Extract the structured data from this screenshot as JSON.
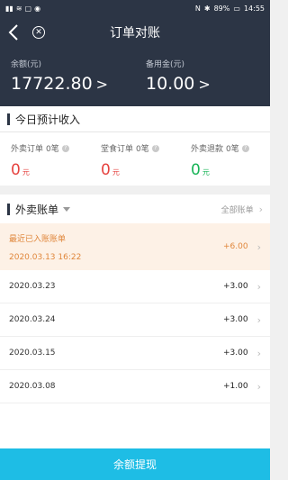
{
  "status": {
    "left_icons": [
      "signal-icon",
      "wifi-icon",
      "message-icon",
      "app-icon"
    ],
    "battery": "89%",
    "time": "14:55"
  },
  "nav": {
    "title": "订单对账",
    "back_icon": "back-icon",
    "close_icon": "close-icon"
  },
  "summary": {
    "balance_label": "余额(元)",
    "balance_value": "17722.80",
    "reserve_label": "备用金(元)",
    "reserve_value": "10.00",
    "chevron": ">"
  },
  "income": {
    "title": "今日预计收入",
    "items": [
      {
        "label": "外卖订单",
        "count": "0笔",
        "value": "0",
        "unit": "元"
      },
      {
        "label": "堂食订单",
        "count": "0笔",
        "value": "0",
        "unit": "元"
      },
      {
        "label": "外卖退款",
        "count": "0笔",
        "value": "0",
        "unit": "元"
      }
    ]
  },
  "bill": {
    "title": "外卖账单",
    "all_label": "全部账单",
    "recent": {
      "label": "最近已入账账单",
      "date": "2020.03.13 16:22",
      "amount": "+6.00"
    },
    "rows": [
      {
        "date": "2020.03.23",
        "amount": "+3.00"
      },
      {
        "date": "2020.03.24",
        "amount": "+3.00"
      },
      {
        "date": "2020.03.15",
        "amount": "+3.00"
      },
      {
        "date": "2020.03.08",
        "amount": "+1.00"
      }
    ]
  },
  "footer": {
    "button_label": "余额提现"
  },
  "colors": {
    "header": "#2c3545",
    "accent": "#1ebde5",
    "red": "#e64340",
    "green": "#18b457",
    "orange": "#e0873c"
  }
}
